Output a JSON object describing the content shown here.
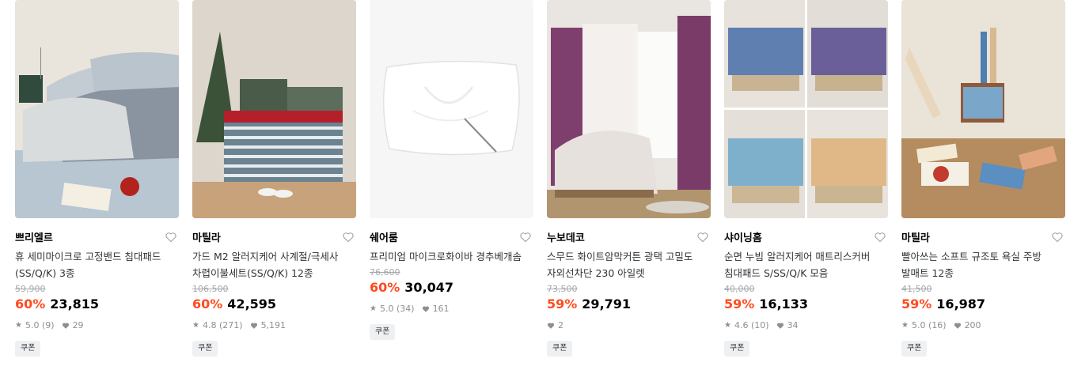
{
  "products": [
    {
      "brand": "쁘리엘르",
      "title": "휴 세미마이크로 고정밴드 침대패드(SS/Q/K) 3종",
      "original_price": "59,900",
      "discount": "60%",
      "price": "23,815",
      "rating": "5.0",
      "review_count": "(9)",
      "likes": "29",
      "badge": "쿠폰",
      "image": "quilted-mattress-pad-photo"
    },
    {
      "brand": "마틸라",
      "title": "가드 M2 알러지케어 사계절/극세사 차렵이불세트(SS/Q/K) 12종",
      "original_price": "106,500",
      "discount": "60%",
      "price": "42,595",
      "rating": "4.8",
      "review_count": "(271)",
      "likes": "5,191",
      "badge": "쿠폰",
      "image": "striped-bedding-set-photo"
    },
    {
      "brand": "쉐어룸",
      "title": "프리미엄 마이크로화이바 경추베개솜",
      "original_price": "76,600",
      "discount": "60%",
      "price": "30,047",
      "rating": "5.0",
      "review_count": "(34)",
      "likes": "161",
      "badge": "쿠폰",
      "image": "white-pillow-photo"
    },
    {
      "brand": "누보데코",
      "title": "스무드 화이트암막커튼 광택 고밀도 자외선차단 230 아일렛",
      "original_price": "73,500",
      "discount": "59%",
      "price": "29,791",
      "rating": "",
      "review_count": "",
      "likes": "2",
      "badge": "쿠폰",
      "image": "purple-curtain-room-photo"
    },
    {
      "brand": "샤이닝홈",
      "title": "순면 누빔 알러지케어 매트리스커버 침대패드 S/SS/Q/K 모음",
      "original_price": "40,000",
      "discount": "59%",
      "price": "16,133",
      "rating": "4.6",
      "review_count": "(10)",
      "likes": "34",
      "badge": "쿠폰",
      "image": "mattress-cover-collage-photo"
    },
    {
      "brand": "마틸라",
      "title": "빨아쓰는 소프트 규조토 욕실 주방 발매트 12종",
      "original_price": "41,500",
      "discount": "59%",
      "price": "16,987",
      "rating": "5.0",
      "review_count": "(16)",
      "likes": "200",
      "badge": "쿠폰",
      "image": "diatomite-mats-photo"
    }
  ],
  "colors": {
    "discount": "#ff4a1f",
    "muted": "#8b8f93",
    "strike": "#a4a8ac"
  }
}
